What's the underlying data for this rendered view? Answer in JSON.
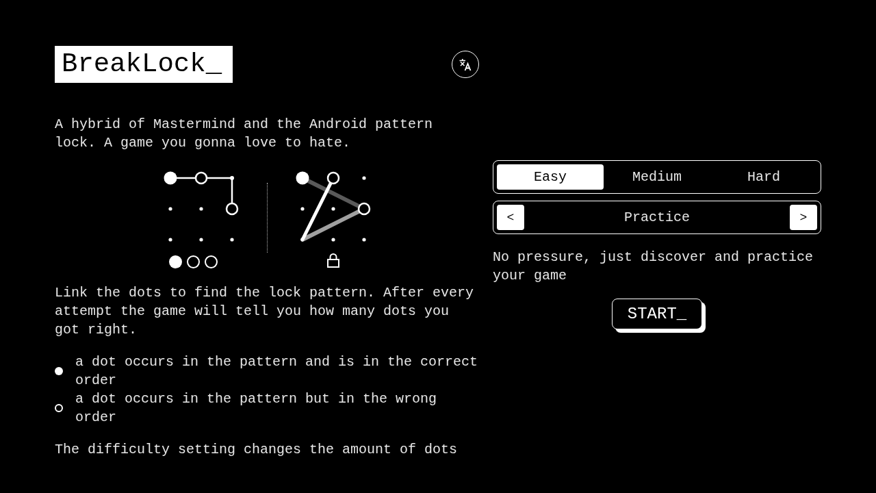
{
  "header": {
    "title": "BreakLock_"
  },
  "intro": "A hybrid of Mastermind and the Android pattern lock. A game you gonna love to hate.",
  "example": {
    "guess_feedback": [
      {
        "kind": "correct"
      },
      {
        "kind": "misplaced"
      },
      {
        "kind": "misplaced"
      }
    ]
  },
  "instructions": "Link the dots to find the lock pattern. After every attempt the game will tell you how many dots you got right.",
  "legend": [
    {
      "kind": "correct",
      "text": "a dot occurs in the pattern and is in the correct order"
    },
    {
      "kind": "misplaced",
      "text": "a dot occurs in the pattern but in the wrong order"
    }
  ],
  "difficulty_note": "The difficulty setting changes the amount of dots",
  "difficulty_tabs": [
    {
      "label": "Easy",
      "selected": true
    },
    {
      "label": "Medium",
      "selected": false
    },
    {
      "label": "Hard",
      "selected": false
    }
  ],
  "mode_selector": {
    "previous": "<",
    "mode": "Practice",
    "next": ">"
  },
  "mode_description": "No pressure, just discover and practice your game",
  "start_button": "START_"
}
